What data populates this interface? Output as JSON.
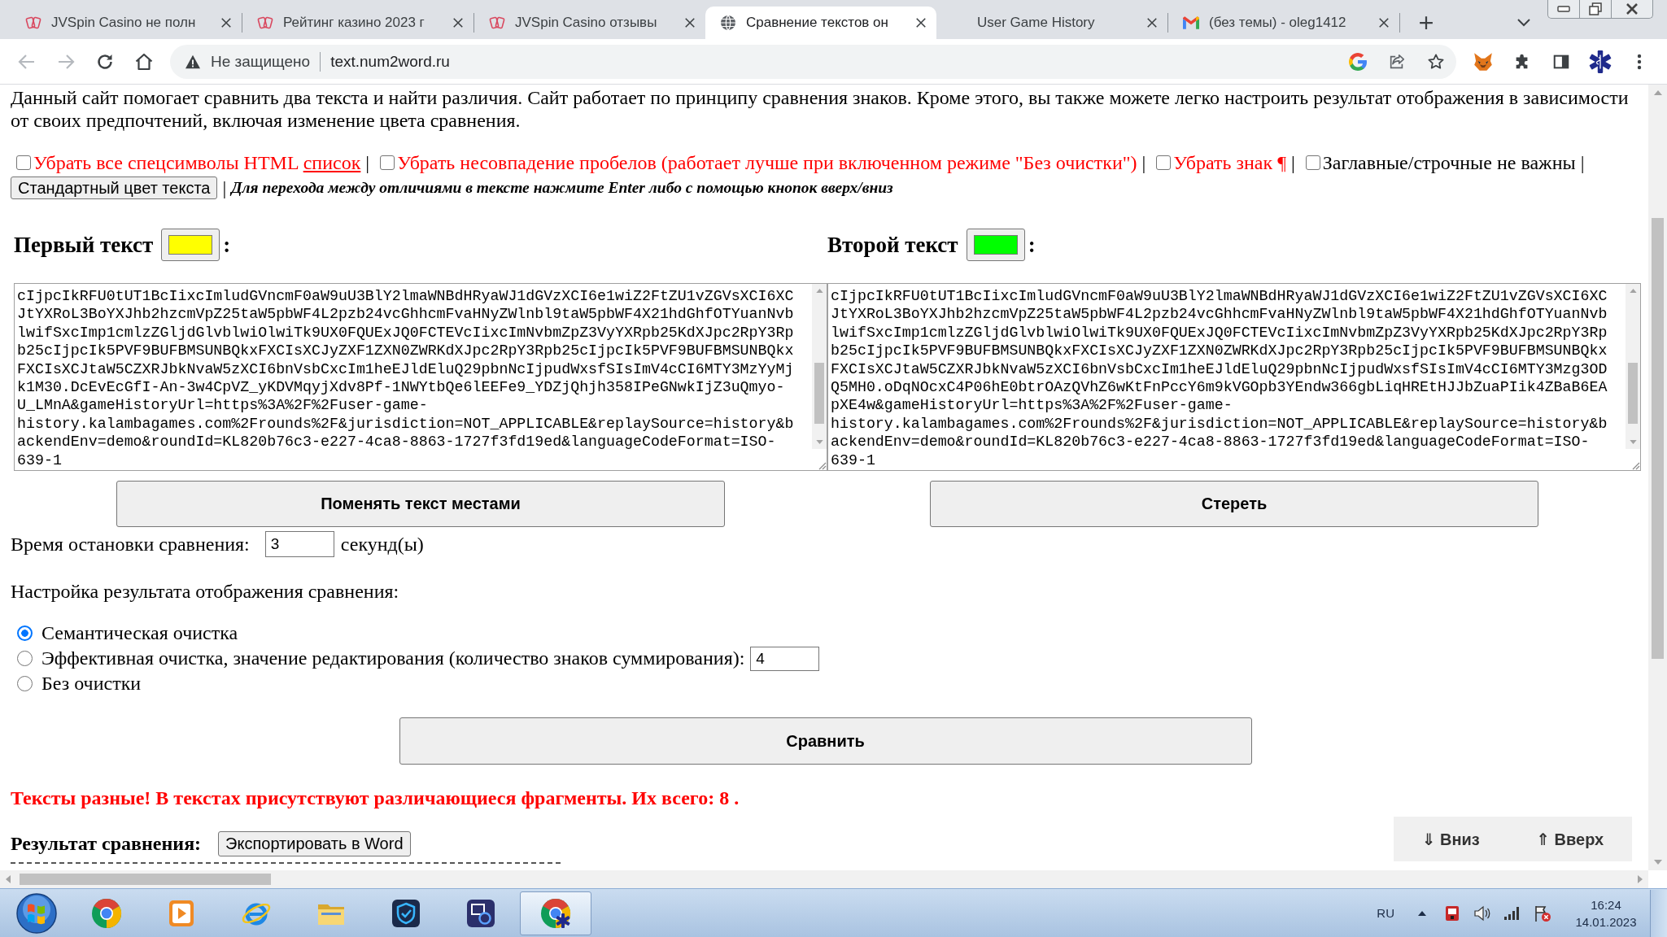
{
  "browser": {
    "tabs": [
      {
        "title": "JVSpin Casino не полн",
        "kind": "cards",
        "selected": false
      },
      {
        "title": "Рейтинг казино 2023 г",
        "kind": "cards",
        "selected": false
      },
      {
        "title": "JVSpin Casino отзывы",
        "kind": "cards",
        "selected": false
      },
      {
        "title": "Сравнение текстов он",
        "kind": "globe",
        "selected": true
      },
      {
        "title": "User Game History",
        "kind": "blank",
        "selected": false
      },
      {
        "title": "(без темы) - oleg1412",
        "kind": "mail",
        "selected": false
      }
    ],
    "address_bar": {
      "security_label": "Не защищено",
      "url": "text.num2word.ru"
    }
  },
  "page": {
    "intro": "Данный сайт помогает сравнить два текста и найти различия. Сайт работает по принципу сравнения знаков. Кроме этого, вы также можете легко настроить результат отображения в зависимости от своих предпочтений, включая изменение цвета сравнения.",
    "options": [
      {
        "label": "Убрать все спецсимволы HTML",
        "link": "список",
        "checked": false,
        "color": "#ff0000",
        "separator": "|"
      },
      {
        "label": "Убрать несовпадение пробелов (работает лучше при включенном режиме \"Без очистки\")",
        "checked": false,
        "color": "#ff0000",
        "separator": "|"
      },
      {
        "label": "Убрать знак ¶",
        "checked": false,
        "color": "#ff0000",
        "separator": "|"
      },
      {
        "label": "Заглавные/строчные не важны",
        "checked": false,
        "color": "#000000",
        "separator": "|"
      }
    ],
    "reset_color_button": "Стандартный цвет текста",
    "hint_separator": "|",
    "hint": "Для перехода между отличиями в тексте нажмите Enter либо с помощью кнопок вверх/вниз",
    "texts": [
      {
        "heading": "Первый текст",
        "color": "#ffff00",
        "suffix": ":",
        "lines": [
          "cIjpcIkRFU0tUT1BcIixcImludGVncmF0aW9uU3BlY2lmaWNBdHRyaWJ1dGVzXCI6e1wiZ2FtZU1vZGVsXCI6XC",
          "JtYXRoL3BoYXJhb2hzcmVpZ25taW5pbWF4L2pzb24vcGhhcmFvaHNyZWlnbl9taW5pbWF4X21hdGhfOTYuanNvb",
          "lwifSxcImp1cmlzZGljdGlvblwiOlwiTk9UX0FQUExJQ0FCTEVcIixcImNvbmZpZ3VyYXRpb25KdXJpc2RpY3Rp",
          "b25cIjpcIk5PVF9BUFBMSUNBQkxFXCIsXCJyZXF1ZXN0ZWRKdXJpc2RpY3Rpb25cIjpcIk5PVF9BUFBMSUNBQkx",
          "FXCIsXCJtaW5CZXRJbkNvaW5zXCI6bnVsbCxcIm1heEJldEluQ29pbnNcIjpudWxsfSIsImV4cCI6MTY3MzYyMj",
          "k1M30.DcEvEcGfI-An-3w4CpVZ_yKDVMqyjXdv8Pf-1NWYtbQe6lEEFe9_YDZjQhjh358IPeGNwkIjZ3uQmyo-",
          "U_LMnA&gameHistoryUrl=https%3A%2F%2Fuser-game-",
          "history.kalambagames.com%2Frounds%2F&jurisdiction=NOT_APPLICABLE&replaySource=history&b",
          "ackendEnv=demo&roundId=KL820b76c3-e227-4ca8-8863-1727f3fd19ed&languageCodeFormat=ISO-",
          "639-1"
        ],
        "button": "Поменять текст местами"
      },
      {
        "heading": "Второй текст",
        "color": "#00ff00",
        "suffix": ":",
        "lines": [
          "cIjpcIkRFU0tUT1BcIixcImludGVncmF0aW9uU3BlY2lmaWNBdHRyaWJ1dGVzXCI6e1wiZ2FtZU1vZGVsXCI6XC",
          "JtYXRoL3BoYXJhb2hzcmVpZ25taW5pbWF4L2pzb24vcGhhcmFvaHNyZWlnbl9taW5pbWF4X21hdGhfOTYuanNvb",
          "lwifSxcImp1cmlzZGljdGlvblwiOlwiTk9UX0FQUExJQ0FCTEVcIixcImNvbmZpZ3VyYXRpb25KdXJpc2RpY3Rp",
          "b25cIjpcIk5PVF9BUFBMSUNBQkxFXCIsXCJyZXF1ZXN0ZWRKdXJpc2RpY3Rpb25cIjpcIk5PVF9BUFBMSUNBQkx",
          "FXCIsXCJtaW5CZXRJbkNvaW5zXCI6bnVsbCxcIm1heEJldEluQ29pbnNcIjpudWxsfSIsImV4cCI6MTY3Mzg3OD",
          "Q5MH0.oDqNOcxC4P06hE0btrOAzQVhZ6wKtFnPccY6m9kVGOpb3YEndw366gbLiqHREtHJJbZuaPIik4ZBaB6EA",
          "pXE4w&gameHistoryUrl=https%3A%2F%2Fuser-game-",
          "history.kalambagames.com%2Frounds%2F&jurisdiction=NOT_APPLICABLE&replaySource=history&b",
          "ackendEnv=demo&roundId=KL820b76c3-e227-4ca8-8863-1727f3fd19ed&languageCodeFormat=ISO-",
          "639-1"
        ],
        "button": "Стереть"
      }
    ],
    "stop_time": {
      "label": "Время остановки сравнения:",
      "value": "3",
      "unit": "секунд(ы)"
    },
    "display_settings": {
      "title": "Настройка результата отображения сравнения:",
      "modes": [
        {
          "label": "Семантическая очистка",
          "selected": true
        },
        {
          "label": "Эффективная очистка, значение редактирования (количество знаков суммирования):",
          "selected": false,
          "value": "4"
        },
        {
          "label": "Без очистки",
          "selected": false
        }
      ]
    },
    "compare_button": "Сравнить",
    "result_message": "Тексты разные! В текстах присутствуют различающиеся фрагменты. Их всего: 8 .",
    "result": {
      "label": "Результат сравнения:",
      "export_button": "Экспортировать в Word"
    },
    "nav_buttons": [
      "⇓ Вниз",
      "⇑ Вверх"
    ]
  },
  "taskbar": {
    "apps": [
      {
        "kind": "browser",
        "selected": false
      },
      {
        "kind": "media",
        "selected": false
      },
      {
        "kind": "web",
        "selected": false
      },
      {
        "kind": "folder",
        "selected": false
      },
      {
        "kind": "shield",
        "selected": false
      },
      {
        "kind": "remote",
        "selected": false
      },
      {
        "kind": "profile-browser",
        "selected": true
      }
    ],
    "language": "RU",
    "time": "16:24",
    "date": "14.01.2023"
  }
}
